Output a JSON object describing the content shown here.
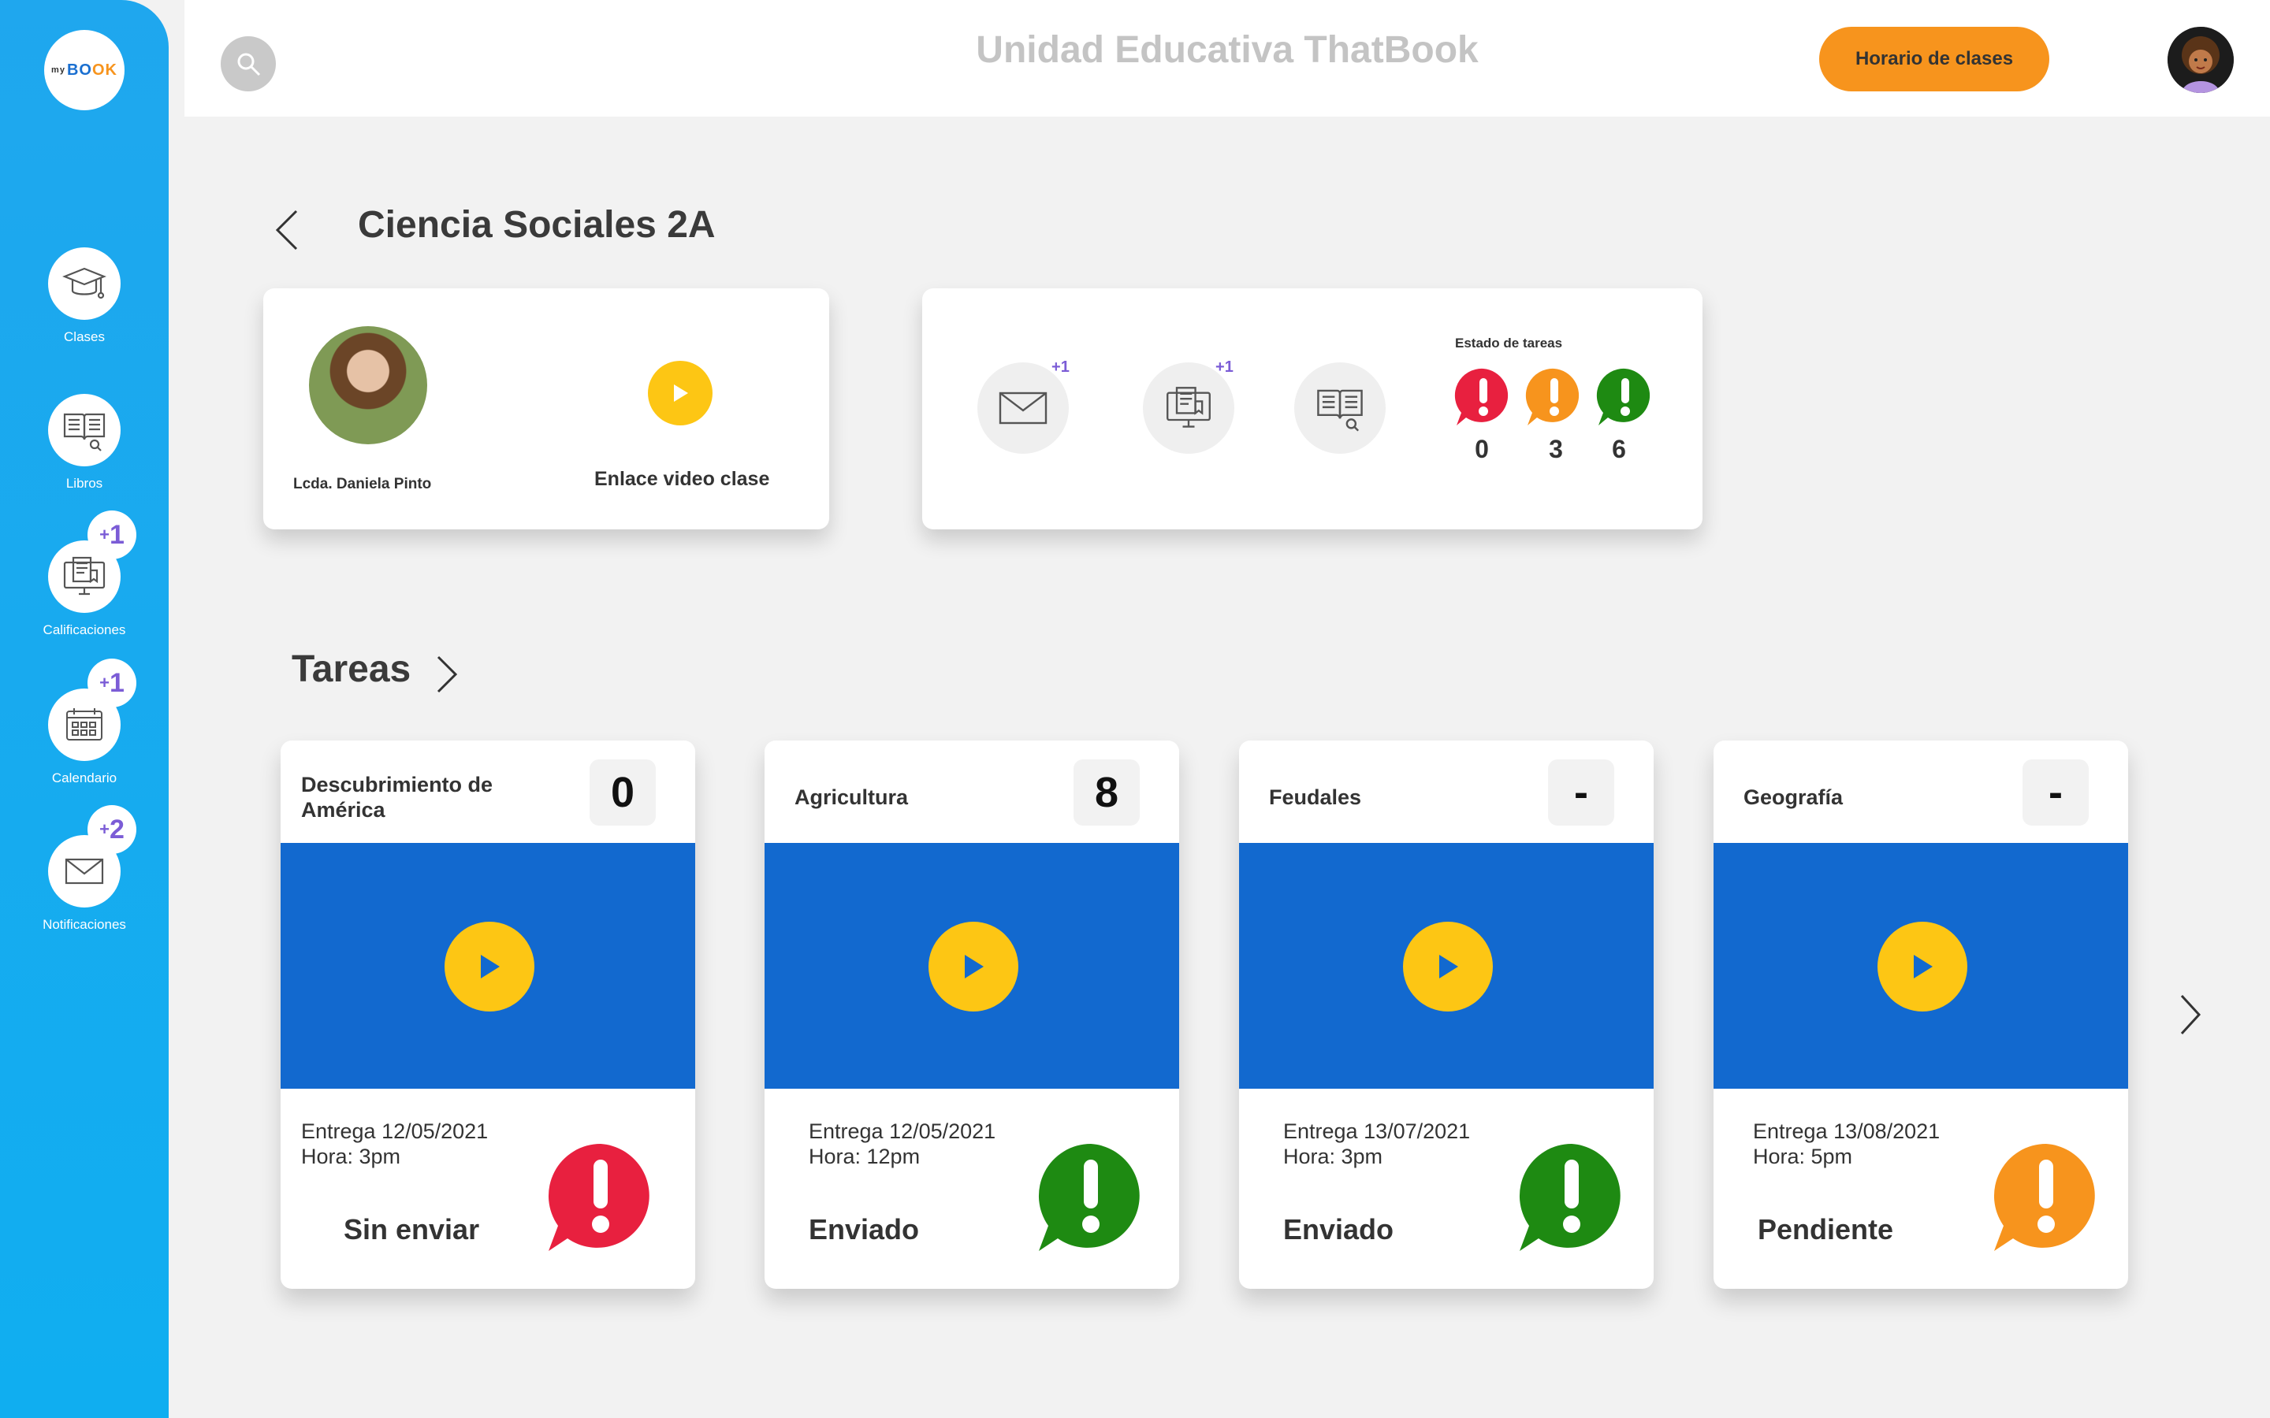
{
  "app": {
    "logo_prefix": "my",
    "logo_word_a": "BO",
    "logo_word_b": "OK",
    "title": "Unidad Educativa ThatBook",
    "schedule_button": "Horario de clases"
  },
  "sidebar": {
    "items": [
      {
        "label": "Clases",
        "icon": "graduation-cap-icon",
        "badge": ""
      },
      {
        "label": "Libros",
        "icon": "book-icon",
        "badge": ""
      },
      {
        "label": "Calificaciones",
        "icon": "certificate-icon",
        "badge": "1"
      },
      {
        "label": "Calendario",
        "icon": "calendar-icon",
        "badge": "1"
      },
      {
        "label": "Notificaciones",
        "icon": "envelope-icon",
        "badge": "2"
      }
    ],
    "badge_prefix": "+"
  },
  "page": {
    "title": "Ciencia Sociales 2A"
  },
  "teacher": {
    "name": "Lcda. Daniela Pinto",
    "video_label": "Enlace video clase"
  },
  "status_panel": {
    "mail_badge": "1",
    "grades_badge": "1",
    "badge_prefix": "+",
    "label": "Estado de tareas",
    "counts": [
      {
        "value": "0",
        "color": "#e8203f"
      },
      {
        "value": "3",
        "color": "#f7941d"
      },
      {
        "value": "6",
        "color": "#1e8a12"
      }
    ]
  },
  "tasks_section": {
    "title": "Tareas",
    "tasks": [
      {
        "title": "Descubrimiento de América",
        "score": "0",
        "due": "Entrega 12/05/2021",
        "time": "Hora: 3pm",
        "status": "Sin enviar",
        "status_color": "#e8203f"
      },
      {
        "title": "Agricultura",
        "score": "8",
        "due": "Entrega 12/05/2021",
        "time": "Hora: 12pm",
        "status": "Enviado",
        "status_color": "#1e8a12"
      },
      {
        "title": "Feudales",
        "score": "-",
        "due": "Entrega 13/07/2021",
        "time": "Hora: 3pm",
        "status": "Enviado",
        "status_color": "#1e8a12"
      },
      {
        "title": "Geografía",
        "score": "-",
        "due": "Entrega 13/08/2021",
        "time": "Hora: 5pm",
        "status": "Pendiente",
        "status_color": "#f7941d"
      }
    ]
  },
  "colors": {
    "sidebar": "#10aef0",
    "accent": "#f7941d",
    "media": "#1269cf",
    "play": "#fdc614",
    "badge": "#7b5cd6"
  }
}
